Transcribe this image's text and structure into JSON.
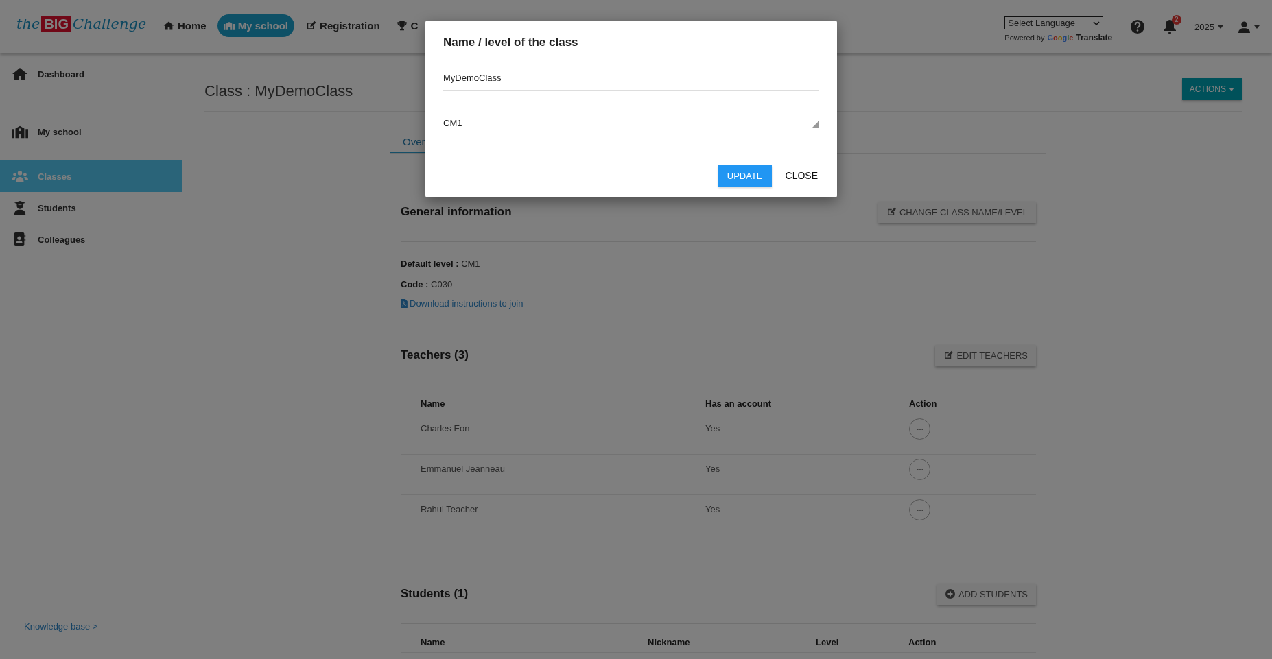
{
  "header": {
    "logo": {
      "prefix": "the",
      "brand": "BIG",
      "suffix": "Challenge"
    },
    "nav": [
      {
        "label": "Home",
        "kind": "home",
        "selected": false
      },
      {
        "label": "My school",
        "kind": "school",
        "selected": true
      },
      {
        "label": "Registration",
        "kind": "edit",
        "selected": false
      },
      {
        "label": "C",
        "kind": "trophy",
        "selected": false
      }
    ],
    "language_select": {
      "value": "Select Language"
    },
    "powered_by": "Powered by",
    "google": "Google",
    "translate": "Translate",
    "notifications": "2",
    "year": "2025"
  },
  "sidebar": {
    "sections": [
      [
        {
          "label": "Dashboard",
          "kind": "home",
          "selected": false
        }
      ],
      [
        {
          "label": "My school",
          "kind": "school",
          "selected": false
        },
        {
          "label": "Classes",
          "kind": "users",
          "selected": true
        },
        {
          "label": "Students",
          "kind": "graduate",
          "selected": false
        },
        {
          "label": "Colleagues",
          "kind": "contacts",
          "selected": false
        }
      ]
    ],
    "footer_link": "Knowledge base >"
  },
  "page": {
    "title": "Class : MyDemoClass",
    "actions_button": "ACTIONS",
    "tabs": [
      {
        "label": "Over",
        "selected": true
      }
    ],
    "general": {
      "heading": "General information",
      "button": "CHANGE CLASS NAME/LEVEL",
      "fields": [
        {
          "label": "Default level :",
          "value": "CM1"
        },
        {
          "label": "Code :",
          "value": "C030"
        }
      ],
      "link": "Download instructions to join"
    },
    "teachers": {
      "heading": "Teachers (3)",
      "button": "EDIT TEACHERS",
      "columns": [
        "Name",
        "Has an account",
        "Action"
      ],
      "rows": [
        {
          "name": "Charles Eon",
          "has_account": "Yes"
        },
        {
          "name": "Emmanuel Jeanneau",
          "has_account": "Yes"
        },
        {
          "name": "Rahul Teacher",
          "has_account": "Yes"
        }
      ]
    },
    "students": {
      "heading": "Students (1)",
      "button": "ADD STUDENTS",
      "columns": [
        "Name",
        "Nickname",
        "Level",
        "Action"
      ]
    }
  },
  "modal": {
    "title": "Name / level of the class",
    "name_field": {
      "value": "MyDemoClass"
    },
    "level_select": {
      "value": "CM1"
    },
    "buttons": [
      {
        "label": "UPDATE",
        "kind": "primary"
      },
      {
        "label": "CLOSE",
        "kind": "flat"
      }
    ]
  }
}
